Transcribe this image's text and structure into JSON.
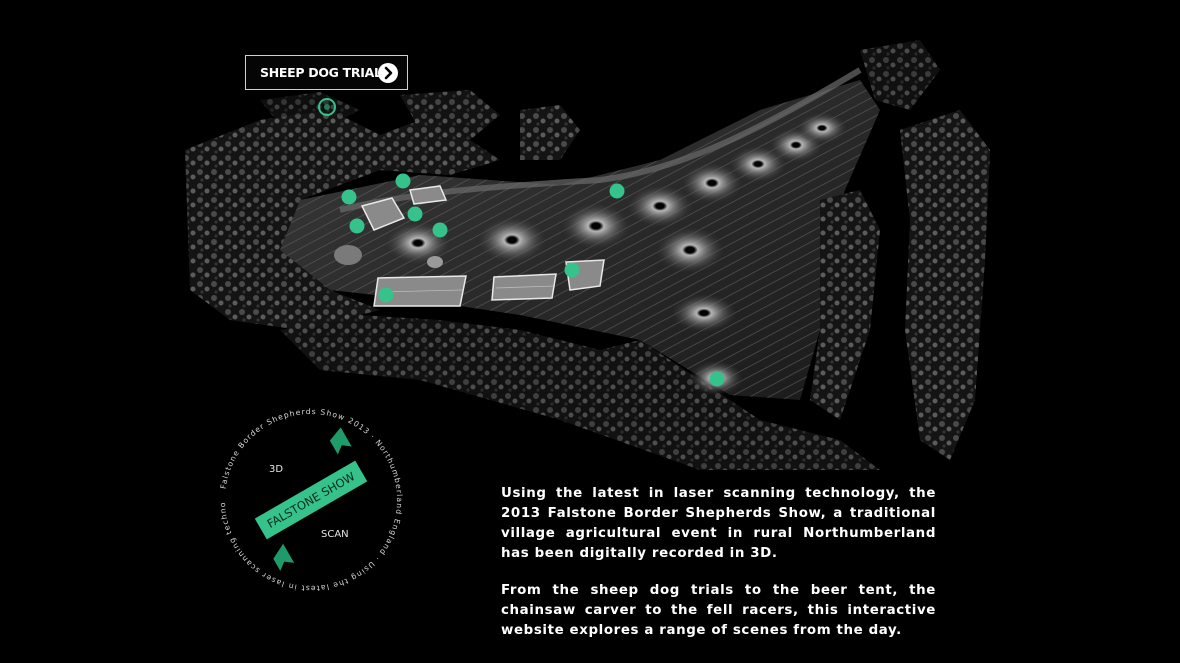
{
  "tooltip": {
    "label": "SHEEP DOG TRIAL",
    "icon": "chevron-right-circle-icon"
  },
  "badge": {
    "ring_text": "Falstone Border Shepherds Show 2013 · Northumberland England · Using the latest in laser scanning technology ·",
    "label_3d": "3D",
    "label_scan": "SCAN",
    "ribbon": "FALSTONE SHOW"
  },
  "description": {
    "p1": "Using the latest in laser scanning technology, the 2013 Falstone Border Shepherds Show, a traditional village agricultural event in rural Northumberland has been digitally recorded in 3D.",
    "p2": "From the sheep dog trials to the beer tent, the chainsaw carver to the fell racers, this interactive website explores a range of scenes from the day."
  },
  "colors": {
    "accent": "#35c28b",
    "background": "#000000"
  }
}
